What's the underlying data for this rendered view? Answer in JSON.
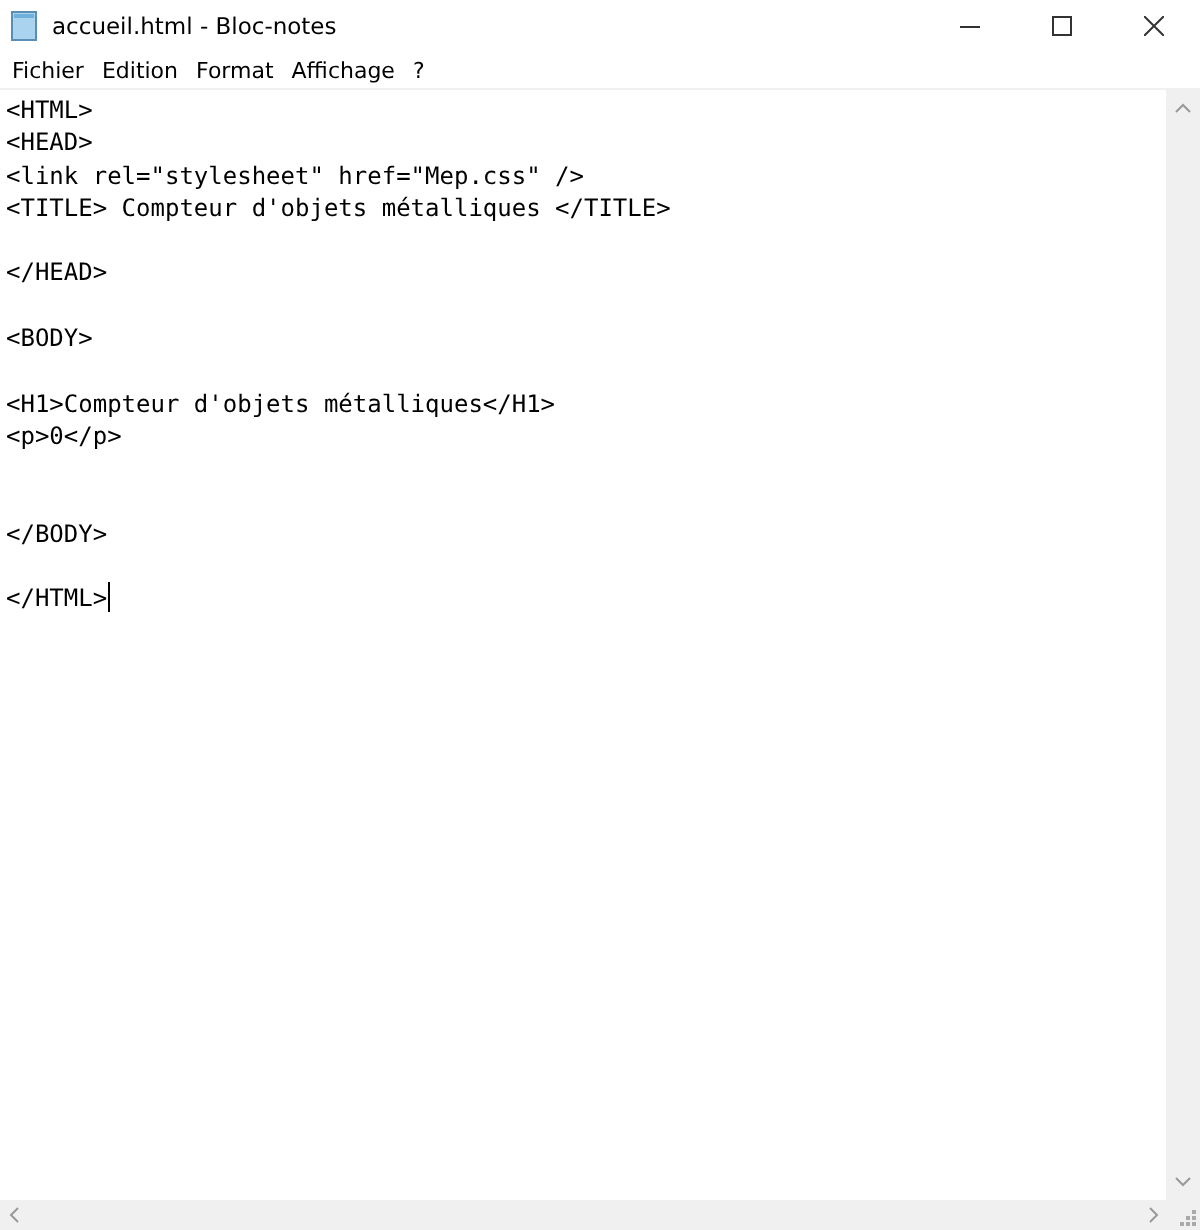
{
  "window": {
    "title": "accueil.html - Bloc-notes"
  },
  "menu": [
    "Fichier",
    "Edition",
    "Format",
    "Affichage",
    "?"
  ],
  "editor": {
    "text": "<HTML>\n<HEAD>\n<link rel=\"stylesheet\" href=\"Mep.css\" />\n<TITLE> Compteur d'objets métalliques </TITLE>\n\n</HEAD>\n\n<BODY>\n\n<H1>Compteur d'objets métalliques</H1>\n<p>0</p>\n\n\n</BODY>\n\n</HTML>"
  }
}
